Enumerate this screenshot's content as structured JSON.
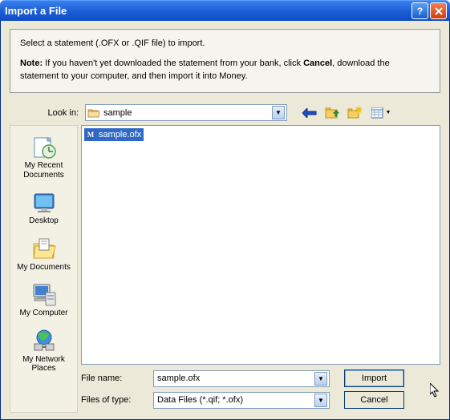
{
  "title": "Import a File",
  "info": {
    "line1": "Select a statement (.OFX or .QIF file) to import.",
    "note_label": "Note:",
    "line2a": " If you haven't yet downloaded the statement from your bank, click ",
    "cancel_strong": "Cancel",
    "line2b": ", download the statement to your computer, and then import it into Money."
  },
  "lookin": {
    "label": "Look in:",
    "value": "sample"
  },
  "places": {
    "recent": "My Recent Documents",
    "desktop": "Desktop",
    "mydocs": "My Documents",
    "mycomp": "My Computer",
    "network": "My Network Places"
  },
  "files": {
    "selected": "sample.ofx"
  },
  "filename": {
    "label": "File name:",
    "value": "sample.ofx"
  },
  "filetype": {
    "label": "Files of type:",
    "value": "Data Files (*.qif; *.ofx)"
  },
  "buttons": {
    "import": "Import",
    "cancel": "Cancel"
  }
}
